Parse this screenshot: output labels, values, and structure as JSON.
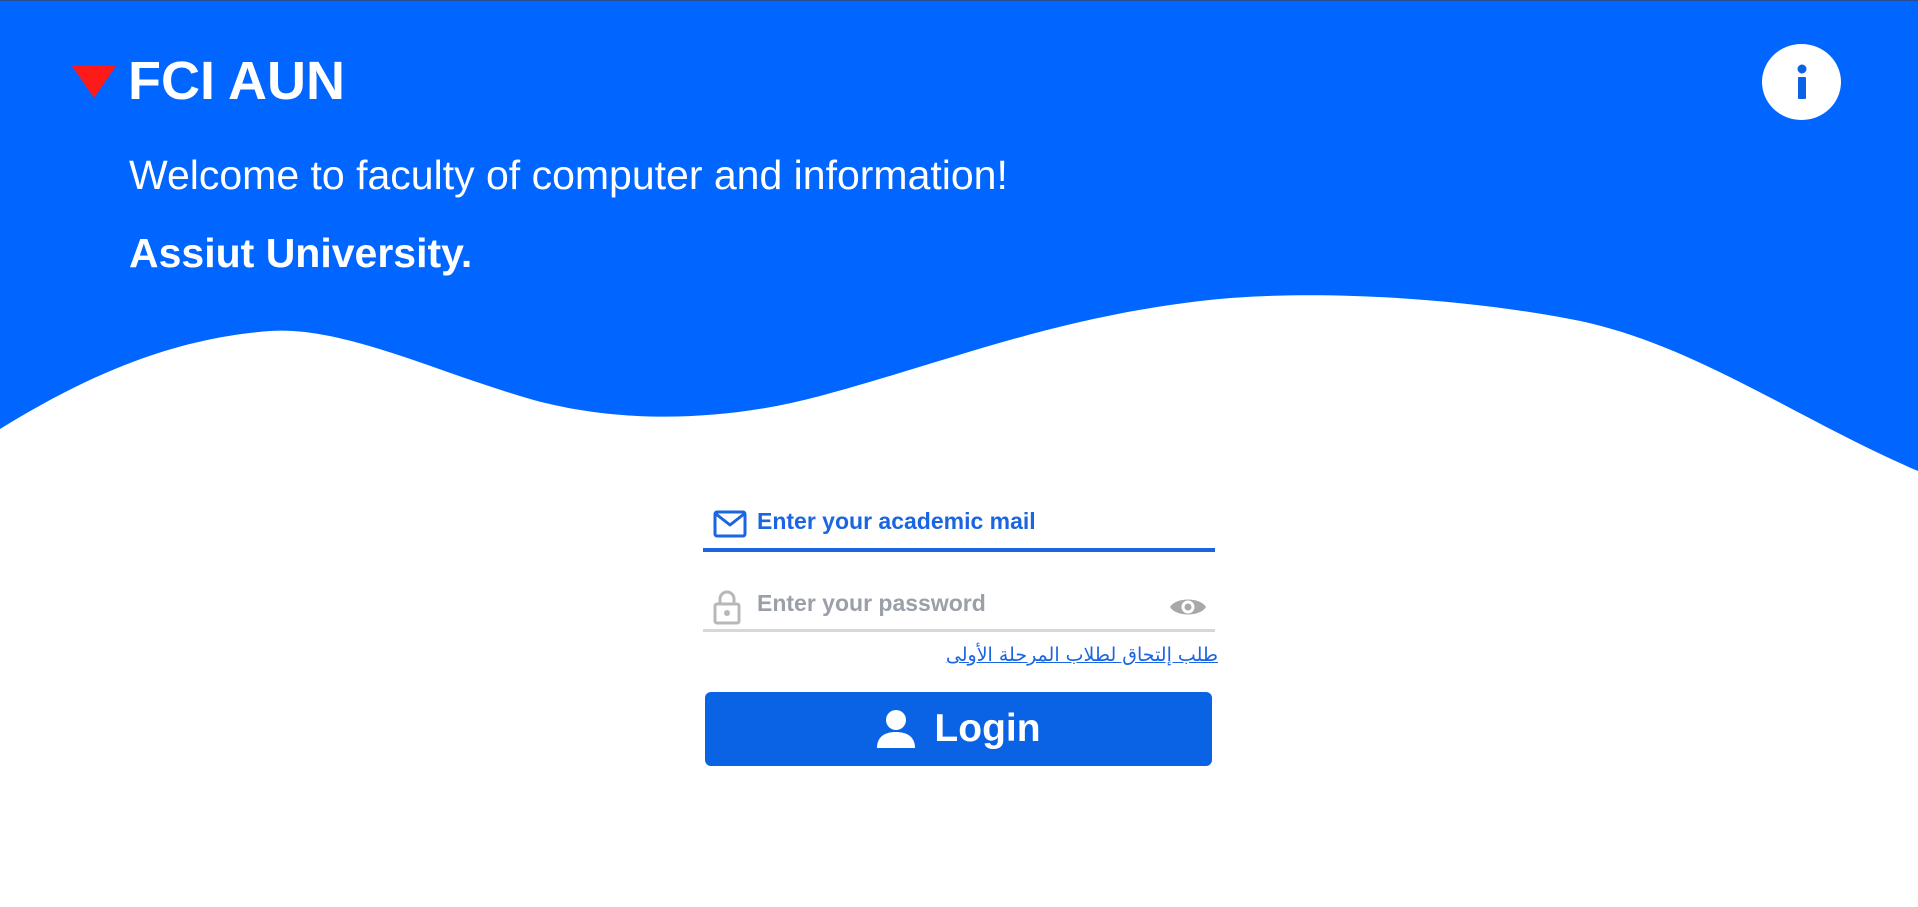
{
  "header": {
    "logo_text": "FCI AUN",
    "welcome_text": "Welcome to faculty of computer and information!",
    "university_text": "Assiut University.",
    "info_icon": "info-icon"
  },
  "login_form": {
    "email_placeholder": "Enter your academic mail",
    "email_value": "",
    "email_icon": "mail-icon",
    "password_placeholder": "Enter your password",
    "password_value": "",
    "password_icon": "lock-icon",
    "visibility_icon": "eye-icon",
    "verify_link_text": "طلب إلتحاق لطلاب المرحلة الأولى",
    "login_label": "Login",
    "login_icon": "user-icon"
  },
  "colors": {
    "brand_blue": "#0066ff",
    "accent_red": "#ff1a1a",
    "button_blue": "#0a62e5",
    "link_blue": "#1b65e0",
    "muted_gray": "#9a9fa8"
  }
}
